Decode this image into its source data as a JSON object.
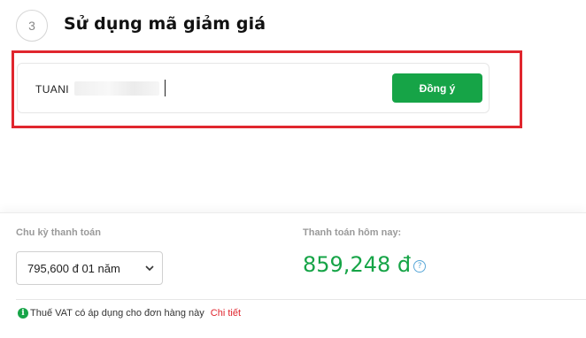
{
  "step": {
    "number": "3",
    "title": "Sử dụng mã giảm giá"
  },
  "coupon": {
    "value": "TUANI",
    "apply_label": "Đồng ý"
  },
  "payment": {
    "cycle_label": "Chu kỳ thanh toán",
    "cycle_selected": "795,600 đ 01 năm",
    "today_label": "Thanh toán hôm nay:",
    "today_amount": "859,248 đ",
    "help_glyph": "?"
  },
  "vat": {
    "info_glyph": "i",
    "text": "Thuế VAT có áp dụng cho đơn hàng này",
    "link": "Chi tiết"
  },
  "colors": {
    "accent_green": "#16a447",
    "highlight_red": "#e0262e"
  },
  "icons": {
    "select": "chevron-down-icon",
    "help": "help-icon",
    "info": "info-icon"
  }
}
